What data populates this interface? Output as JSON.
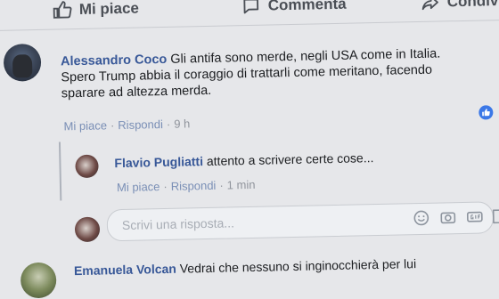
{
  "actions": {
    "like_label": "Mi piace",
    "comment_label": "Commenta",
    "share_label": "Condivid"
  },
  "comment1": {
    "author": "Alessandro Coco",
    "text_line1": "Gli antifa sono merde, negli USA come in Italia.",
    "text_line2": "Spero Trump abbia il coraggio di trattarli come meritano, facendo",
    "text_line3": "sparare ad altezza merda.",
    "like": "Mi piace",
    "reply": "Rispondi",
    "time": "9 h"
  },
  "reply1": {
    "author": "Flavio Pugliatti",
    "text": "attento a scrivere certe cose...",
    "like": "Mi piace",
    "reply": "Rispondi",
    "time": "1 min"
  },
  "reply_box": {
    "placeholder": "Scrivi una risposta..."
  },
  "comment3": {
    "author": "Emanuela Volcan",
    "text": "Vedrai che nessuno si inginocchierà per lui"
  },
  "colors": {
    "author": "#385898",
    "link": "#7a8fb6",
    "reaction": "#3b78e7"
  }
}
